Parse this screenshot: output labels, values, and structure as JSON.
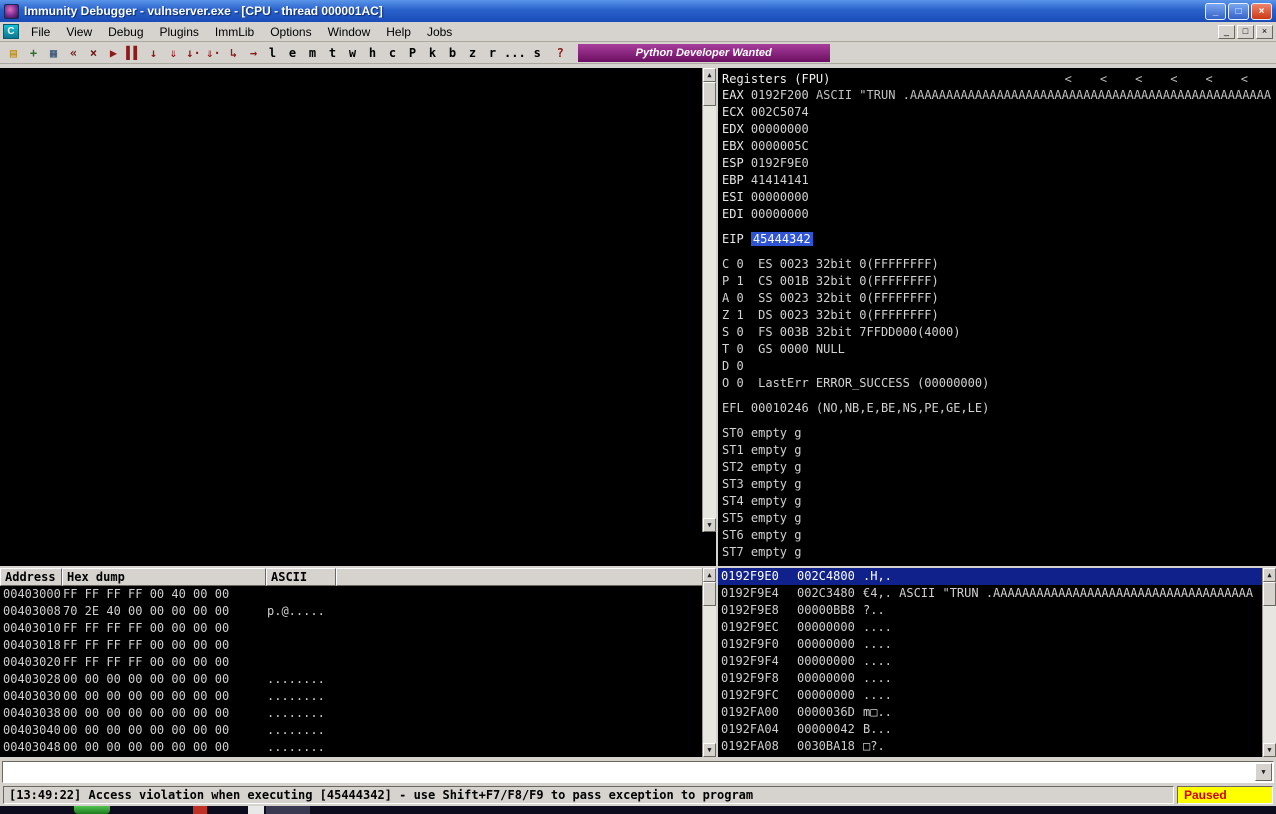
{
  "colors": {
    "selection_bg": "#10218c",
    "eip_bg": "#2f55d4",
    "paused_bg": "#ffff00",
    "paused_fg": "#d40000",
    "banner_bg": "#951487"
  },
  "icons": {
    "scroll_up": "▲",
    "scroll_down": "▼",
    "dropdown": "▼"
  },
  "titlebar": {
    "title": "Immunity Debugger - vulnserver.exe - [CPU - thread 000001AC]",
    "minimize": "_",
    "maximize": "□",
    "close": "×"
  },
  "menubar": {
    "icon_letter": "C",
    "items": [
      "File",
      "View",
      "Debug",
      "Plugins",
      "ImmLib",
      "Options",
      "Window",
      "Help",
      "Jobs"
    ],
    "mdi_minimize": "_",
    "mdi_restore": "□",
    "mdi_close": "×"
  },
  "toolbar": {
    "buttons": [
      {
        "name": "open-file",
        "glyph": "▤",
        "color": "#b8860b"
      },
      {
        "name": "attach",
        "glyph": "+",
        "color": "#2e6e2e"
      },
      {
        "name": "windows",
        "glyph": "▦",
        "color": "#34506e"
      },
      {
        "name": "restart",
        "glyph": "«",
        "color": "#6b1515"
      },
      {
        "name": "close-process",
        "glyph": "×",
        "color": "#6b1515"
      },
      {
        "name": "run",
        "glyph": "▶",
        "color": "#8b1a1a"
      },
      {
        "name": "pause",
        "glyph": "▌▌",
        "color": "#8b1a1a"
      },
      {
        "name": "step-into",
        "glyph": "↓",
        "color": "#8b1a1a"
      },
      {
        "name": "step-over",
        "glyph": "⇓",
        "color": "#8b1a1a"
      },
      {
        "name": "trace-into",
        "glyph": "↓·",
        "color": "#8b1a1a"
      },
      {
        "name": "trace-over",
        "glyph": "⇓·",
        "color": "#8b1a1a"
      },
      {
        "name": "until-return",
        "glyph": "↳",
        "color": "#8b1a1a"
      },
      {
        "name": "goto",
        "glyph": "→",
        "color": "#8b1a1a"
      }
    ],
    "letters": [
      "l",
      "e",
      "m",
      "t",
      "w",
      "h",
      "c",
      "P",
      "k",
      "b",
      "z",
      "r",
      "...",
      "s"
    ],
    "help_letter": "?",
    "banner": "Python Developer Wanted"
  },
  "registers": {
    "title": "Registers (FPU)",
    "arrows": [
      "<",
      "<",
      "<",
      "<",
      "<",
      "<"
    ],
    "gpr": [
      {
        "name": "EAX",
        "value": "0192F200",
        "note": "ASCII \"TRUN .AAAAAAAAAAAAAAAAAAAAAAAAAAAAAAAAAAAAAAAAAAAAAAAAAA"
      },
      {
        "name": "ECX",
        "value": "002C5074",
        "note": ""
      },
      {
        "name": "EDX",
        "value": "00000000",
        "note": ""
      },
      {
        "name": "EBX",
        "value": "0000005C",
        "note": ""
      },
      {
        "name": "ESP",
        "value": "0192F9E0",
        "note": ""
      },
      {
        "name": "EBP",
        "value": "41414141",
        "note": ""
      },
      {
        "name": "ESI",
        "value": "00000000",
        "note": ""
      },
      {
        "name": "EDI",
        "value": "00000000",
        "note": ""
      }
    ],
    "eip_name": "EIP",
    "eip_value": "45444342",
    "flags": [
      "C 0  ES 0023 32bit 0(FFFFFFFF)",
      "P 1  CS 001B 32bit 0(FFFFFFFF)",
      "A 0  SS 0023 32bit 0(FFFFFFFF)",
      "Z 1  DS 0023 32bit 0(FFFFFFFF)",
      "S 0  FS 003B 32bit 7FFDD000(4000)",
      "T 0  GS 0000 NULL",
      "D 0",
      "O 0  LastErr ERROR_SUCCESS (00000000)"
    ],
    "efl": "EFL 00010246 (NO,NB,E,BE,NS,PE,GE,LE)",
    "st": [
      "ST0 empty g",
      "ST1 empty g",
      "ST2 empty g",
      "ST3 empty g",
      "ST4 empty g",
      "ST5 empty g",
      "ST6 empty g",
      "ST7 empty g"
    ]
  },
  "hexdump": {
    "headers": [
      "Address",
      "Hex dump",
      "ASCII"
    ],
    "rows": [
      {
        "address": "00403000",
        "hex": "FF FF FF FF 00 40 00 00",
        "ascii": ""
      },
      {
        "address": "00403008",
        "hex": "70 2E 40 00 00 00 00 00",
        "ascii": "p.@....."
      },
      {
        "address": "00403010",
        "hex": "FF FF FF FF 00 00 00 00",
        "ascii": ""
      },
      {
        "address": "00403018",
        "hex": "FF FF FF FF 00 00 00 00",
        "ascii": ""
      },
      {
        "address": "00403020",
        "hex": "FF FF FF FF 00 00 00 00",
        "ascii": ""
      },
      {
        "address": "00403028",
        "hex": "00 00 00 00 00 00 00 00",
        "ascii": "........"
      },
      {
        "address": "00403030",
        "hex": "00 00 00 00 00 00 00 00",
        "ascii": "........"
      },
      {
        "address": "00403038",
        "hex": "00 00 00 00 00 00 00 00",
        "ascii": "........"
      },
      {
        "address": "00403040",
        "hex": "00 00 00 00 00 00 00 00",
        "ascii": "........"
      },
      {
        "address": "00403048",
        "hex": "00 00 00 00 00 00 00 00",
        "ascii": "........"
      }
    ]
  },
  "stack": {
    "rows": [
      {
        "address": "0192F9E0",
        "value": "002C4800",
        "ascii": ".H,.",
        "selected": true
      },
      {
        "address": "0192F9E4",
        "value": "002C3480",
        "ascii": "€4,. ASCII \"TRUN .AAAAAAAAAAAAAAAAAAAAAAAAAAAAAAAAAAAA"
      },
      {
        "address": "0192F9E8",
        "value": "00000BB8",
        "ascii": "?.."
      },
      {
        "address": "0192F9EC",
        "value": "00000000",
        "ascii": "...."
      },
      {
        "address": "0192F9F0",
        "value": "00000000",
        "ascii": "...."
      },
      {
        "address": "0192F9F4",
        "value": "00000000",
        "ascii": "...."
      },
      {
        "address": "0192F9F8",
        "value": "00000000",
        "ascii": "...."
      },
      {
        "address": "0192F9FC",
        "value": "00000000",
        "ascii": "...."
      },
      {
        "address": "0192FA00",
        "value": "0000036D",
        "ascii": "m□.."
      },
      {
        "address": "0192FA04",
        "value": "00000042",
        "ascii": "B..."
      },
      {
        "address": "0192FA08",
        "value": "0030BA18",
        "ascii": "□?."
      }
    ]
  },
  "command_bar": {
    "value": ""
  },
  "statusbar": {
    "message": "[13:49:22] Access violation when executing [45444342] - use Shift+F7/F8/F9 to pass exception to program",
    "state": "Paused"
  }
}
